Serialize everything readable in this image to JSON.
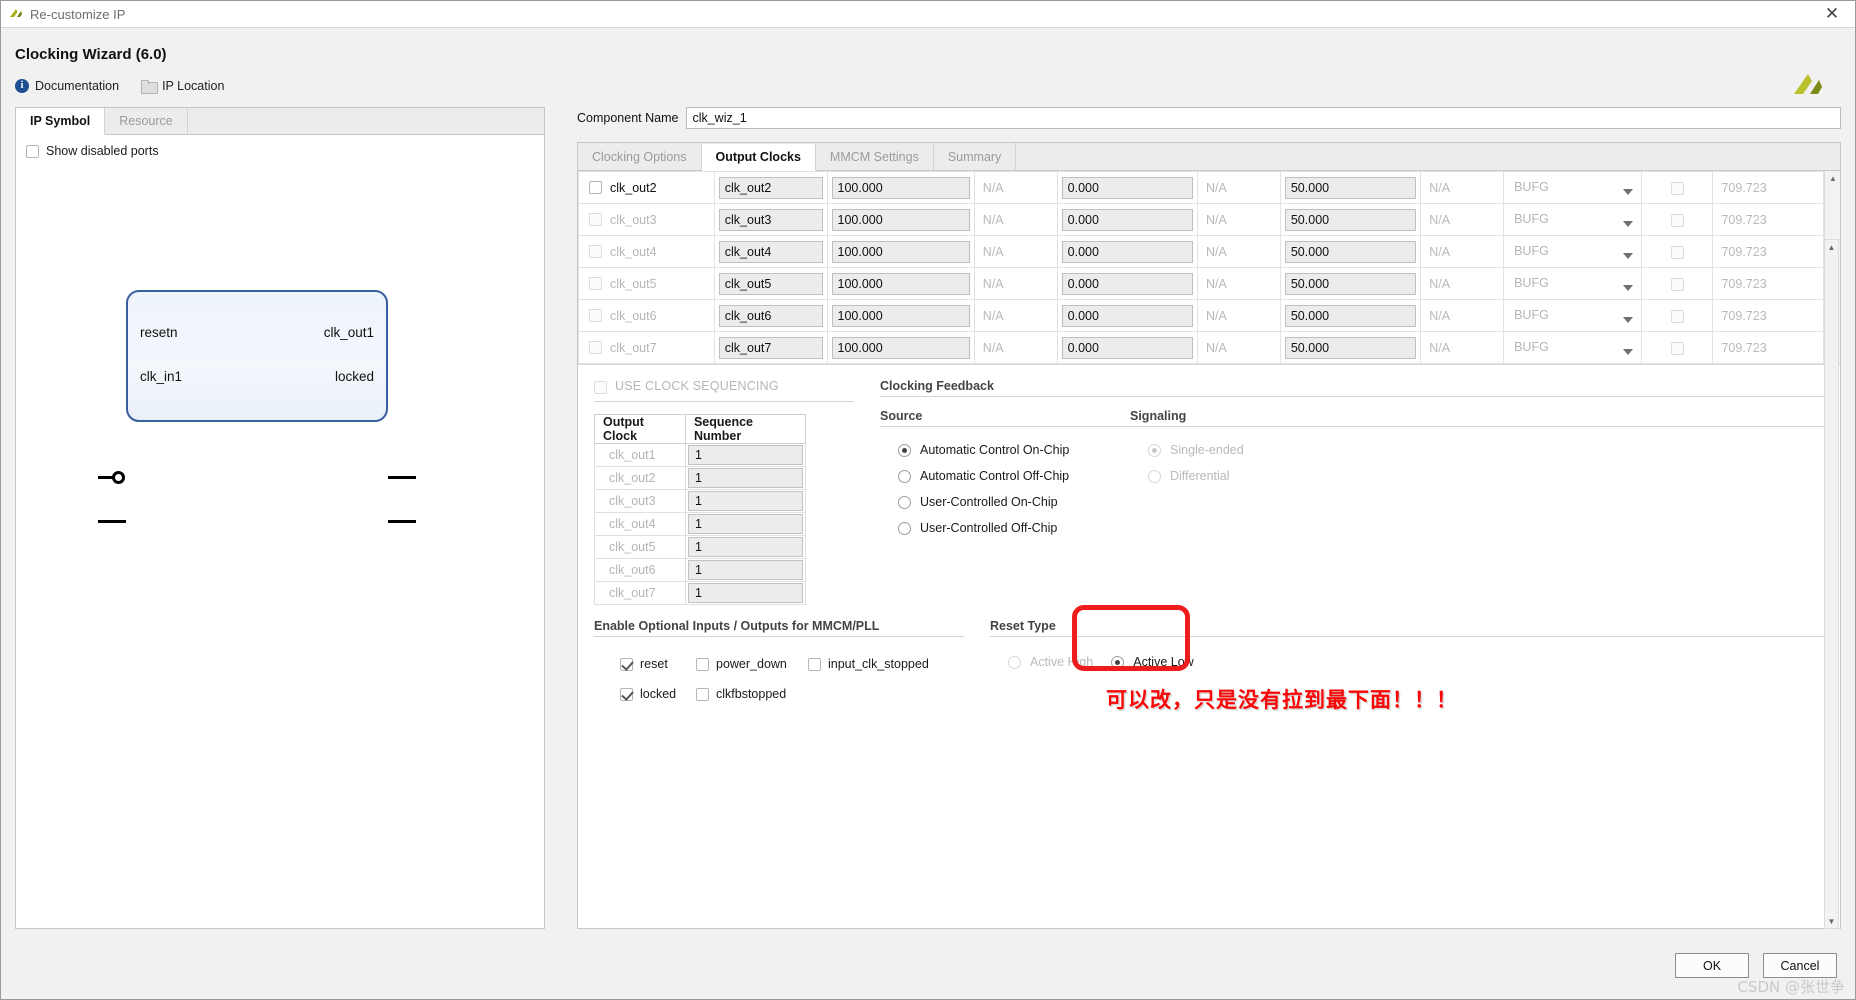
{
  "window": {
    "title": "Re-customize IP",
    "close_glyph": "✕",
    "app_icon": "xilinx-logo-icon"
  },
  "header": {
    "wizard_title": "Clocking Wizard (6.0)",
    "links": [
      {
        "label": "Documentation",
        "icon": "info-icon"
      },
      {
        "label": "IP Location",
        "icon": "folder-icon"
      }
    ]
  },
  "left_panel": {
    "tabs": [
      {
        "label": "IP Symbol",
        "active": true
      },
      {
        "label": "Resource",
        "active": false
      }
    ],
    "show_disabled_ports": {
      "label": "Show disabled ports",
      "checked": false
    },
    "symbol": {
      "inputs": [
        "resetn",
        "clk_in1"
      ],
      "outputs": [
        "clk_out1",
        "locked"
      ]
    }
  },
  "component": {
    "label": "Component Name",
    "value": "clk_wiz_1"
  },
  "right_tabs": [
    {
      "label": "Clocking Options",
      "active": false
    },
    {
      "label": "Output Clocks",
      "active": true
    },
    {
      "label": "MMCM Settings",
      "active": false
    },
    {
      "label": "Summary",
      "active": false
    }
  ],
  "clock_table": {
    "rows": [
      {
        "name": "clk_out2",
        "enabled": true,
        "port": "clk_out2",
        "out_freq_req": "100.000",
        "out_freq_act": "N/A",
        "phase_req": "0.000",
        "phase_act": "N/A",
        "duty_req": "50.000",
        "duty_act": "N/A",
        "drive": "BUFG",
        "use_fine_ps": false,
        "max_freq": "709.723"
      },
      {
        "name": "clk_out3",
        "enabled": false,
        "port": "clk_out3",
        "out_freq_req": "100.000",
        "out_freq_act": "N/A",
        "phase_req": "0.000",
        "phase_act": "N/A",
        "duty_req": "50.000",
        "duty_act": "N/A",
        "drive": "BUFG",
        "use_fine_ps": false,
        "max_freq": "709.723"
      },
      {
        "name": "clk_out4",
        "enabled": false,
        "port": "clk_out4",
        "out_freq_req": "100.000",
        "out_freq_act": "N/A",
        "phase_req": "0.000",
        "phase_act": "N/A",
        "duty_req": "50.000",
        "duty_act": "N/A",
        "drive": "BUFG",
        "use_fine_ps": false,
        "max_freq": "709.723"
      },
      {
        "name": "clk_out5",
        "enabled": false,
        "port": "clk_out5",
        "out_freq_req": "100.000",
        "out_freq_act": "N/A",
        "phase_req": "0.000",
        "phase_act": "N/A",
        "duty_req": "50.000",
        "duty_act": "N/A",
        "drive": "BUFG",
        "use_fine_ps": false,
        "max_freq": "709.723"
      },
      {
        "name": "clk_out6",
        "enabled": false,
        "port": "clk_out6",
        "out_freq_req": "100.000",
        "out_freq_act": "N/A",
        "phase_req": "0.000",
        "phase_act": "N/A",
        "duty_req": "50.000",
        "duty_act": "N/A",
        "drive": "BUFG",
        "use_fine_ps": false,
        "max_freq": "709.723"
      },
      {
        "name": "clk_out7",
        "enabled": false,
        "port": "clk_out7",
        "out_freq_req": "100.000",
        "out_freq_act": "N/A",
        "phase_req": "0.000",
        "phase_act": "N/A",
        "duty_req": "50.000",
        "duty_act": "N/A",
        "drive": "BUFG",
        "use_fine_ps": false,
        "max_freq": "709.723"
      }
    ]
  },
  "sequencing": {
    "use_clock_sequencing": {
      "label": "USE CLOCK SEQUENCING",
      "checked": false
    },
    "headers": [
      "Output Clock",
      "Sequence Number"
    ],
    "rows": [
      {
        "clock": "clk_out1",
        "seq": "1"
      },
      {
        "clock": "clk_out2",
        "seq": "1"
      },
      {
        "clock": "clk_out3",
        "seq": "1"
      },
      {
        "clock": "clk_out4",
        "seq": "1"
      },
      {
        "clock": "clk_out5",
        "seq": "1"
      },
      {
        "clock": "clk_out6",
        "seq": "1"
      },
      {
        "clock": "clk_out7",
        "seq": "1"
      }
    ]
  },
  "clocking_feedback": {
    "title": "Clocking Feedback",
    "source": {
      "title": "Source",
      "options": [
        {
          "label": "Automatic Control On-Chip",
          "selected": true
        },
        {
          "label": "Automatic Control Off-Chip",
          "selected": false
        },
        {
          "label": "User-Controlled On-Chip",
          "selected": false
        },
        {
          "label": "User-Controlled Off-Chip",
          "selected": false
        }
      ]
    },
    "signaling": {
      "title": "Signaling",
      "disabled": true,
      "options": [
        {
          "label": "Single-ended",
          "selected": true
        },
        {
          "label": "Differential",
          "selected": false
        }
      ]
    }
  },
  "annotation": {
    "text": "可以改，只是没有拉到最下面！！！",
    "color": "#fa0505"
  },
  "optional_io": {
    "title": "Enable Optional Inputs / Outputs for MMCM/PLL",
    "row1": [
      {
        "label": "reset",
        "checked": true
      },
      {
        "label": "power_down",
        "checked": false
      },
      {
        "label": "input_clk_stopped",
        "checked": false
      }
    ],
    "row2": [
      {
        "label": "locked",
        "checked": true
      },
      {
        "label": "clkfbstopped",
        "checked": false
      }
    ]
  },
  "reset_type": {
    "title": "Reset Type",
    "options": [
      {
        "label": "Active High",
        "selected": false,
        "disabled": true
      },
      {
        "label": "Active Low",
        "selected": true,
        "disabled": false
      }
    ],
    "highlight_color": "#ee1c1c"
  },
  "footer": {
    "ok_label": "OK",
    "cancel_label": "Cancel",
    "watermark": "CSDN @张世争"
  }
}
